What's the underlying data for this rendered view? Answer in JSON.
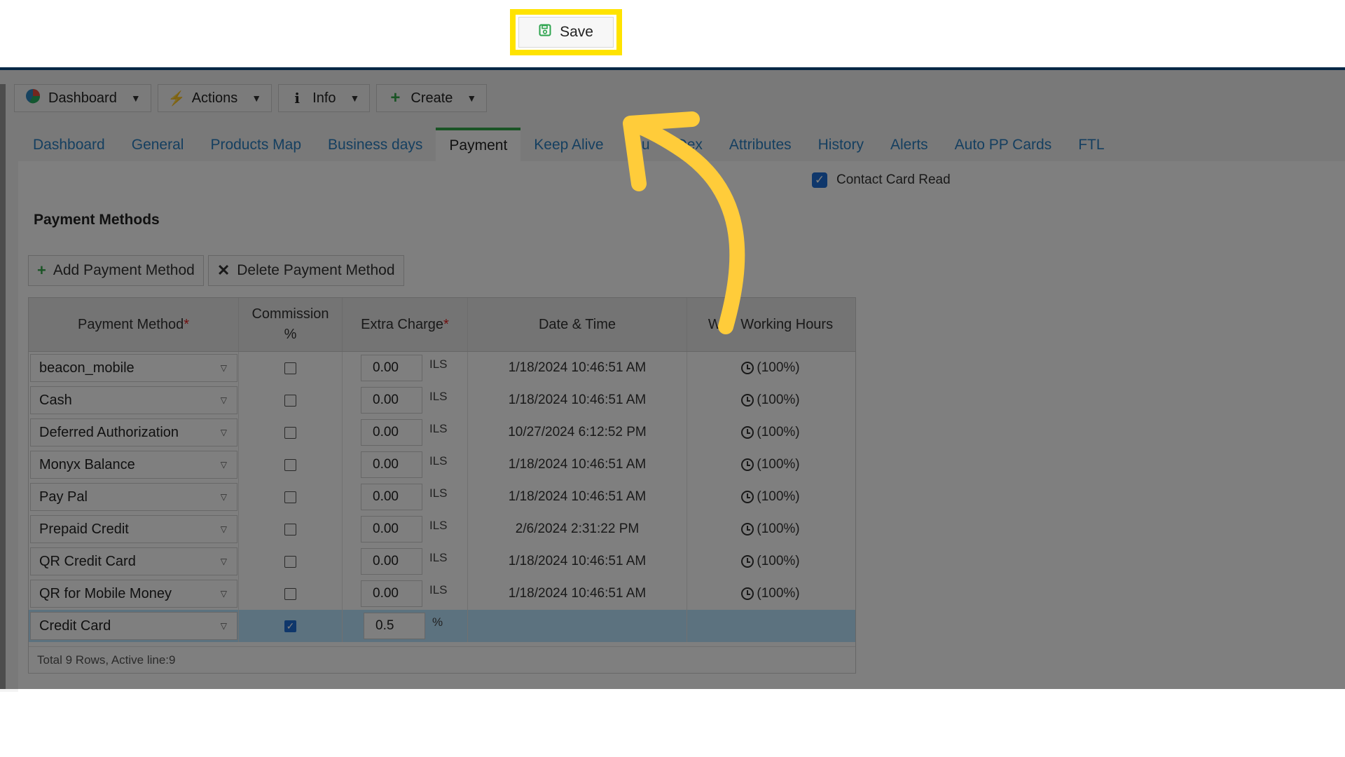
{
  "toolbar": {
    "dashboard": {
      "label": "Dashboard",
      "icon": "pie-chart-icon"
    },
    "actions": {
      "label": "Actions",
      "icon": "lightning-icon"
    },
    "info": {
      "label": "Info",
      "icon": "info-icon"
    },
    "create": {
      "label": "Create",
      "icon": "plus-icon"
    },
    "save": {
      "label": "Save",
      "icon": "floppy-disk-icon"
    }
  },
  "tabs": [
    {
      "label": "Dashboard"
    },
    {
      "label": "General"
    },
    {
      "label": "Products Map"
    },
    {
      "label": "Business days"
    },
    {
      "label": "Payment",
      "active": true
    },
    {
      "label": "Keep Alive"
    },
    {
      "label": "Qu"
    },
    {
      "label": "Dex"
    },
    {
      "label": "Attributes"
    },
    {
      "label": "History"
    },
    {
      "label": "Alerts"
    },
    {
      "label": "Auto PP Cards"
    },
    {
      "label": "FTL"
    }
  ],
  "contact_card_read": {
    "label": "Contact Card Read",
    "checked": true
  },
  "payment_methods": {
    "title": "Payment Methods",
    "add_label": "Add Payment Method",
    "delete_label": "Delete Payment Method",
    "columns": {
      "method": "Payment Method",
      "commission_line1": "Commission",
      "commission_line2": "%",
      "extra_charge": "Extra Charge",
      "date_time": "Date & Time",
      "working_hours": "We   Working Hours"
    },
    "required_mark": "*",
    "rows": [
      {
        "method": "beacon_mobile",
        "commission": false,
        "extra": "0.00",
        "unit": "ILS",
        "datetime": "1/18/2024 10:46:51 AM",
        "hours": "(100%)"
      },
      {
        "method": "Cash",
        "commission": false,
        "extra": "0.00",
        "unit": "ILS",
        "datetime": "1/18/2024 10:46:51 AM",
        "hours": "(100%)"
      },
      {
        "method": "Deferred Authorization",
        "commission": false,
        "extra": "0.00",
        "unit": "ILS",
        "datetime": "10/27/2024 6:12:52 PM",
        "hours": "(100%)"
      },
      {
        "method": "Monyx Balance",
        "commission": false,
        "extra": "0.00",
        "unit": "ILS",
        "datetime": "1/18/2024 10:46:51 AM",
        "hours": "(100%)"
      },
      {
        "method": "Pay Pal",
        "commission": false,
        "extra": "0.00",
        "unit": "ILS",
        "datetime": "1/18/2024 10:46:51 AM",
        "hours": "(100%)"
      },
      {
        "method": "Prepaid Credit",
        "commission": false,
        "extra": "0.00",
        "unit": "ILS",
        "datetime": "2/6/2024 2:31:22 PM",
        "hours": "(100%)"
      },
      {
        "method": "QR Credit Card",
        "commission": false,
        "extra": "0.00",
        "unit": "ILS",
        "datetime": "1/18/2024 10:46:51 AM",
        "hours": "(100%)"
      },
      {
        "method": "QR for Mobile Money",
        "commission": false,
        "extra": "0.00",
        "unit": "ILS",
        "datetime": "1/18/2024 10:46:51 AM",
        "hours": "(100%)"
      },
      {
        "method": "Credit Card",
        "commission": true,
        "extra": "0.5",
        "unit": "%",
        "datetime": "",
        "hours": "",
        "active": true
      }
    ],
    "footer": "Total 9 Rows, Active line:9"
  },
  "colors": {
    "accent_tab": "#35a84b",
    "link": "#2a7fc0",
    "highlight": "#ffe300",
    "annotation_arrow": "#ffcc3a",
    "active_row": "#b8e4ff"
  }
}
